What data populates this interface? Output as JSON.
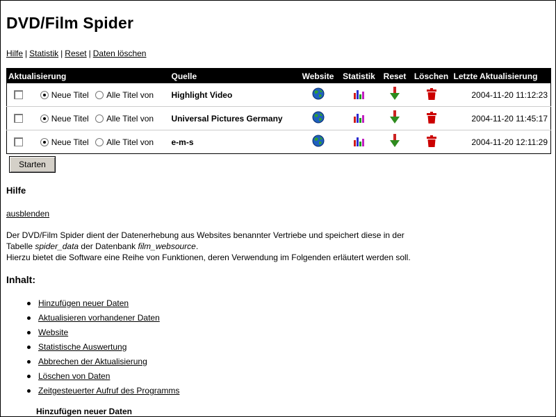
{
  "title": "DVD/Film Spider",
  "nav_links": [
    "Hilfe",
    "Statistik",
    "Reset",
    "Daten löschen"
  ],
  "nav_separator": "|",
  "table": {
    "headers": {
      "update": "Aktualisierung",
      "source": "Quelle",
      "website": "Website",
      "statistics": "Statistik",
      "reset": "Reset",
      "delete": "Löschen",
      "last_update": "Letzte Aktualisierung"
    },
    "option_new": "Neue Titel",
    "option_all": "Alle Titel von",
    "rows": [
      {
        "checked": false,
        "mode": "new",
        "source": "Highlight Video",
        "last_update": "2004-11-20 11:12:23"
      },
      {
        "checked": false,
        "mode": "new",
        "source": "Universal Pictures Germany",
        "last_update": "2004-11-20 11:45:17"
      },
      {
        "checked": false,
        "mode": "new",
        "source": "e-m-s",
        "last_update": "2004-11-20 12:11:29"
      }
    ]
  },
  "start_button": "Starten",
  "help": {
    "heading": "Hilfe",
    "hide_link": "ausblenden",
    "line1": "Der DVD/Film Spider dient der Datenerhebung aus Websites benannter Vertriebe und speichert diese in der",
    "line2_a": "Tabelle ",
    "line2_b": "spider_data",
    "line2_c": " der Datenbank ",
    "line2_d": "film_websource",
    "line2_e": ".",
    "line3": "Hierzu bietet die Software eine Reihe von Funktionen, deren Verwendung im Folgenden erläutert werden soll."
  },
  "contents": {
    "heading": "Inhalt:",
    "items": [
      "Hinzufügen neuer Daten",
      "Aktualisieren vorhandener Daten",
      "Website",
      "Statistische Auswertung",
      "Abbrechen der Aktualisierung",
      "Löschen von Daten",
      "Zeitgesteuerter Aufruf des Programms"
    ]
  },
  "section_heading": "Hinzufügen neuer Daten",
  "icons": {
    "website": "globe-icon",
    "statistics": "bar-chart-icon",
    "reset": "down-arrow-icon",
    "delete": "trash-icon"
  },
  "colors": {
    "header_bg": "#000000",
    "header_text": "#ffffff",
    "button_bg": "#d4d0c8",
    "trash": "#cc0000",
    "arrow": "#2e8b1e",
    "arrow_head": "#cc2222"
  }
}
